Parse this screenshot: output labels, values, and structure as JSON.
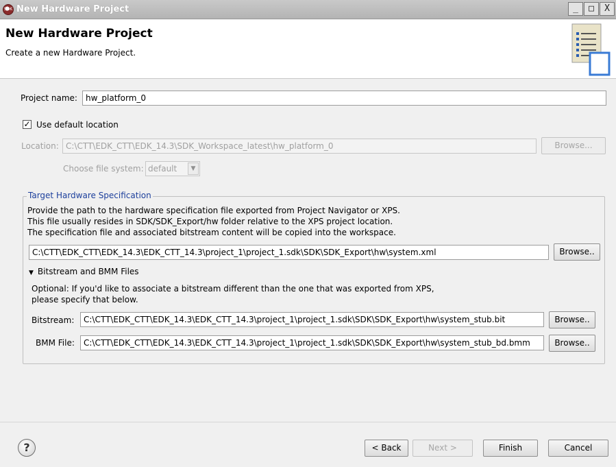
{
  "window": {
    "title": "New Hardware Project",
    "controls": {
      "minimize": "_",
      "maximize": "□",
      "close": "X"
    }
  },
  "banner": {
    "title": "New Hardware Project",
    "description": "Create a new Hardware Project.",
    "icon": "wizard-list-icon"
  },
  "project": {
    "name_label": "Project name:",
    "name_value": "hw_platform_0",
    "use_default_label": "Use default location",
    "use_default_checked": true,
    "location_label": "Location:",
    "location_value": "C:\\CTT\\EDK_CTT\\EDK_14.3\\SDK_Workspace_latest\\hw_platform_0",
    "location_browse": "Browse...",
    "filesystem_label": "Choose file system:",
    "filesystem_value": "default"
  },
  "target": {
    "group_title": "Target Hardware Specification",
    "desc_line1": "Provide the path to the hardware specification file exported from Project Navigator or XPS.",
    "desc_line2": "This file usually resides in SDK/SDK_Export/hw folder relative to the XPS project location.",
    "desc_line3": "The specification file and associated bitstream content will be copied into the workspace.",
    "spec_path": "C:\\CTT\\EDK_CTT\\EDK_14.3\\EDK_CTT_14.3\\project_1\\project_1.sdk\\SDK\\SDK_Export\\hw\\system.xml",
    "spec_browse": "Browse..",
    "expander_label": "Bitstream and BMM Files",
    "optional_line1": "Optional: If you'd like to associate a bitstream different than the one that was exported from XPS,",
    "optional_line2": "please specify that below.",
    "bitstream_label": "Bitstream:",
    "bitstream_value": "C:\\CTT\\EDK_CTT\\EDK_14.3\\EDK_CTT_14.3\\project_1\\project_1.sdk\\SDK\\SDK_Export\\hw\\system_stub.bit",
    "bitstream_browse": "Browse..",
    "bmm_label": "BMM File:",
    "bmm_value": "C:\\CTT\\EDK_CTT\\EDK_14.3\\EDK_CTT_14.3\\project_1\\project_1.sdk\\SDK\\SDK_Export\\hw\\system_stub_bd.bmm",
    "bmm_browse": "Browse.."
  },
  "footer": {
    "help": "?",
    "back": "< Back",
    "next": "Next >",
    "finish": "Finish",
    "cancel": "Cancel"
  },
  "colors": {
    "group_title": "#1c3f9c",
    "titlebar": "#b9b9b9"
  }
}
